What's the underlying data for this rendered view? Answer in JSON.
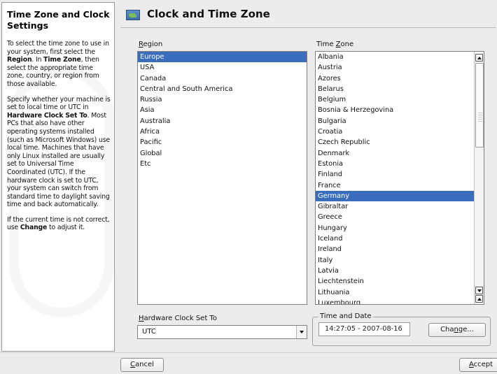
{
  "help": {
    "title": "Time Zone and Clock Settings",
    "paragraphs": [
      [
        {
          "t": "To select the time zone to use in your system, first select the "
        },
        {
          "t": "Region",
          "b": true
        },
        {
          "t": ". In "
        },
        {
          "t": "Time Zone",
          "b": true
        },
        {
          "t": ", then select the appropriate time zone, country, or region from those available."
        }
      ],
      [
        {
          "t": "Specify whether your machine is set to local time or UTC in "
        },
        {
          "t": "Hardware Clock Set To",
          "b": true
        },
        {
          "t": ". Most PCs that also have other operating systems installed (such as Microsoft Windows) use local time. Machines that have only Linux installed are usually set to Universal Time Coordinated (UTC). If the hardware clock is set to UTC, your system can switch from standard time to daylight saving time and back automatically."
        }
      ],
      [
        {
          "t": "If the current time is not correct, use "
        },
        {
          "t": "Change",
          "b": true
        },
        {
          "t": " to adjust it."
        }
      ]
    ]
  },
  "header": {
    "title": "Clock and Time Zone",
    "icon": "world-map-icon"
  },
  "region": {
    "label_pre": "",
    "label_key": "R",
    "label_post": "egion",
    "items": [
      "Europe",
      "USA",
      "Canada",
      "Central and South America",
      "Russia",
      "Asia",
      "Australia",
      "Africa",
      "Pacific",
      "Global",
      "Etc"
    ],
    "selected": 0
  },
  "timezone": {
    "label_pre": "Time ",
    "label_key": "Z",
    "label_post": "one",
    "items": [
      "Albania",
      "Austria",
      "Azores",
      "Belarus",
      "Belgium",
      "Bosnia & Herzegovina",
      "Bulgaria",
      "Croatia",
      "Czech Republic",
      "Denmark",
      "Estonia",
      "Finland",
      "France",
      "Germany",
      "Gibraltar",
      "Greece",
      "Hungary",
      "Iceland",
      "Ireland",
      "Italy",
      "Latvia",
      "Liechtenstein",
      "Lithuania",
      "Luxembourg"
    ],
    "selected": 13,
    "scroll": {
      "position": 0.0,
      "visible_fraction": 0.38
    }
  },
  "hwclock": {
    "label_pre": "",
    "label_key": "H",
    "label_post": "ardware Clock Set To",
    "value": "UTC"
  },
  "timedate": {
    "group_title": "Time and Date",
    "value": "14:27:05 - 2007-08-16",
    "change_pre": "Cha",
    "change_key": "n",
    "change_post": "ge..."
  },
  "footer": {
    "cancel_pre": "",
    "cancel_key": "C",
    "cancel_post": "ancel",
    "accept_pre": "",
    "accept_key": "A",
    "accept_post": "ccept"
  }
}
